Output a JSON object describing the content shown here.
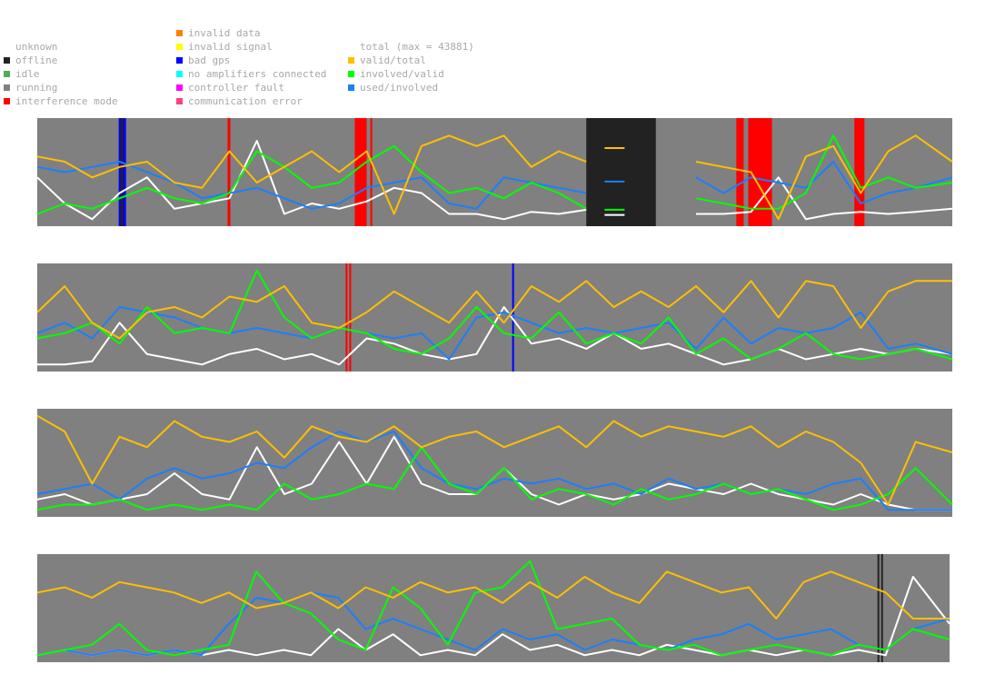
{
  "legend": {
    "status": [
      {
        "label": "unknown",
        "color": null
      },
      {
        "label": "offline",
        "color": "#222222"
      },
      {
        "label": "idle",
        "color": "#4caf50"
      },
      {
        "label": "running",
        "color": "#808080"
      },
      {
        "label": "interference mode",
        "color": "#ff0000"
      }
    ],
    "faults": [
      {
        "label": "invalid data",
        "color": "#ff8000"
      },
      {
        "label": "invalid signal",
        "color": "#ffff00"
      },
      {
        "label": "bad gps",
        "color": "#0000ff"
      },
      {
        "label": "no amplifiers connected",
        "color": "#00ffff"
      },
      {
        "label": "controller fault",
        "color": "#ff00ff"
      },
      {
        "label": "communication error",
        "color": "#ff4080"
      }
    ],
    "series": [
      {
        "label": "total (max = 43881)",
        "color": null
      },
      {
        "label": "valid/total",
        "color": "#ffbf00"
      },
      {
        "label": "involved/valid",
        "color": "#00ff00"
      },
      {
        "label": "used/involved",
        "color": "#1a7fff"
      }
    ]
  },
  "chart_data": {
    "type": "line",
    "background_color": "#808080",
    "series_colors": {
      "total": "#ffffff",
      "valid/total": "#ffbf00",
      "involved/valid": "#00ff00",
      "used/involved": "#1a7fff"
    },
    "ylim": [
      0,
      1
    ],
    "panels": [
      {
        "x": [
          0,
          0.03,
          0.06,
          0.09,
          0.12,
          0.15,
          0.18,
          0.21,
          0.24,
          0.27,
          0.3,
          0.33,
          0.36,
          0.39,
          0.42,
          0.45,
          0.48,
          0.51,
          0.54,
          0.57,
          0.6,
          0.63,
          0.66,
          0.69,
          0.72,
          0.75,
          0.78,
          0.81,
          0.84,
          0.87,
          0.9,
          0.93,
          0.96,
          1
        ],
        "total": [
          0.45,
          0.2,
          0.05,
          0.3,
          0.45,
          0.15,
          0.2,
          0.25,
          0.8,
          0.1,
          0.2,
          0.15,
          0.22,
          0.35,
          0.3,
          0.1,
          0.1,
          0.05,
          0.12,
          0.1,
          0.14,
          null,
          null,
          null,
          0.1,
          0.1,
          0.12,
          0.45,
          0.05,
          0.1,
          0.12,
          0.1,
          0.12,
          0.15
        ],
        "valid/total": [
          0.65,
          0.6,
          0.45,
          0.55,
          0.6,
          0.4,
          0.35,
          0.7,
          0.4,
          0.55,
          0.7,
          0.5,
          0.7,
          0.1,
          0.75,
          0.85,
          0.75,
          0.85,
          0.55,
          0.7,
          0.6,
          null,
          null,
          null,
          0.6,
          0.55,
          0.5,
          0.05,
          0.65,
          0.75,
          0.3,
          0.7,
          0.85,
          0.6
        ],
        "involved/valid": [
          0.1,
          0.2,
          0.15,
          0.25,
          0.35,
          0.25,
          0.2,
          0.3,
          0.7,
          0.55,
          0.35,
          0.4,
          0.6,
          0.75,
          0.5,
          0.3,
          0.35,
          0.25,
          0.4,
          0.3,
          0.15,
          null,
          null,
          null,
          0.25,
          0.2,
          0.15,
          0.15,
          0.3,
          0.85,
          0.35,
          0.45,
          0.35,
          0.4
        ],
        "used/involved": [
          0.55,
          0.5,
          0.55,
          0.6,
          0.5,
          0.4,
          0.25,
          0.3,
          0.35,
          0.25,
          0.15,
          0.2,
          0.35,
          0.4,
          0.45,
          0.2,
          0.15,
          0.45,
          0.4,
          0.35,
          0.3,
          null,
          null,
          null,
          0.45,
          0.3,
          0.45,
          0.4,
          0.35,
          0.6,
          0.2,
          0.3,
          0.35,
          0.45
        ],
        "end_marks": {
          "x": 0.62,
          "valid/total": 0.73,
          "used/involved": 0.41,
          "involved/valid": 0.14,
          "total": 0.09
        },
        "bands": [
          {
            "from": 0.089,
            "to": 0.097,
            "color": "#0000ff"
          },
          {
            "from": 0.091,
            "to": 0.094,
            "color": "#222222"
          },
          {
            "from": 0.208,
            "to": 0.211,
            "color": "#ff0000"
          },
          {
            "from": 0.347,
            "to": 0.36,
            "color": "#ff0000"
          },
          {
            "from": 0.364,
            "to": 0.366,
            "color": "#ff0000"
          },
          {
            "from": 0.6,
            "to": 0.676,
            "color": "#222222"
          },
          {
            "from": 0.764,
            "to": 0.772,
            "color": "#ff0000"
          },
          {
            "from": 0.777,
            "to": 0.803,
            "color": "#ff0000"
          },
          {
            "from": 0.893,
            "to": 0.904,
            "color": "#ff0000"
          }
        ]
      },
      {
        "x": [
          0,
          0.03,
          0.06,
          0.09,
          0.12,
          0.15,
          0.18,
          0.21,
          0.24,
          0.27,
          0.3,
          0.33,
          0.36,
          0.39,
          0.42,
          0.45,
          0.48,
          0.51,
          0.54,
          0.57,
          0.6,
          0.63,
          0.66,
          0.69,
          0.72,
          0.75,
          0.78,
          0.81,
          0.84,
          0.87,
          0.9,
          0.93,
          0.96,
          1
        ],
        "total": [
          0.05,
          0.05,
          0.08,
          0.45,
          0.15,
          0.1,
          0.05,
          0.15,
          0.2,
          0.1,
          0.15,
          0.05,
          0.3,
          0.25,
          0.15,
          0.1,
          0.15,
          0.6,
          0.25,
          0.3,
          0.2,
          0.35,
          0.2,
          0.25,
          0.15,
          0.05,
          0.1,
          0.2,
          0.1,
          0.15,
          0.2,
          0.15,
          0.2,
          0.15
        ],
        "valid/total": [
          0.55,
          0.8,
          0.45,
          0.3,
          0.55,
          0.6,
          0.5,
          0.7,
          0.65,
          0.8,
          0.45,
          0.4,
          0.55,
          0.75,
          0.6,
          0.45,
          0.75,
          0.45,
          0.8,
          0.65,
          0.85,
          0.6,
          0.75,
          0.6,
          0.8,
          0.55,
          0.85,
          0.5,
          0.85,
          0.8,
          0.4,
          0.75,
          0.85,
          0.85
        ],
        "involved/valid": [
          0.3,
          0.35,
          0.45,
          0.25,
          0.6,
          0.35,
          0.4,
          0.35,
          0.95,
          0.5,
          0.3,
          0.4,
          0.35,
          0.2,
          0.15,
          0.3,
          0.6,
          0.35,
          0.3,
          0.55,
          0.25,
          0.35,
          0.25,
          0.5,
          0.15,
          0.3,
          0.1,
          0.2,
          0.35,
          0.15,
          0.1,
          0.15,
          0.2,
          0.1
        ],
        "used/involved": [
          0.35,
          0.45,
          0.3,
          0.6,
          0.55,
          0.5,
          0.4,
          0.35,
          0.4,
          0.35,
          0.3,
          0.4,
          0.35,
          0.3,
          0.35,
          0.1,
          0.5,
          0.55,
          0.45,
          0.35,
          0.4,
          0.35,
          0.4,
          0.45,
          0.2,
          0.5,
          0.25,
          0.4,
          0.35,
          0.4,
          0.55,
          0.2,
          0.25,
          0.15
        ],
        "bands": [
          {
            "from": 0.337,
            "to": 0.339,
            "color": "#ff0000"
          },
          {
            "from": 0.341,
            "to": 0.343,
            "color": "#ff0000"
          },
          {
            "from": 0.519,
            "to": 0.521,
            "color": "#0000ff"
          }
        ]
      },
      {
        "x": [
          0,
          0.03,
          0.06,
          0.09,
          0.12,
          0.15,
          0.18,
          0.21,
          0.24,
          0.27,
          0.3,
          0.33,
          0.36,
          0.39,
          0.42,
          0.45,
          0.48,
          0.51,
          0.54,
          0.57,
          0.6,
          0.63,
          0.66,
          0.69,
          0.72,
          0.75,
          0.78,
          0.81,
          0.84,
          0.87,
          0.9,
          0.93,
          0.96,
          1
        ],
        "total": [
          0.15,
          0.2,
          0.1,
          0.15,
          0.2,
          0.4,
          0.2,
          0.15,
          0.65,
          0.2,
          0.3,
          0.7,
          0.3,
          0.75,
          0.3,
          0.2,
          0.2,
          0.45,
          0.2,
          0.1,
          0.2,
          0.15,
          0.2,
          0.3,
          0.25,
          0.2,
          0.3,
          0.2,
          0.15,
          0.1,
          0.2,
          0.1,
          0.05,
          0.05
        ],
        "valid/total": [
          0.95,
          0.8,
          0.3,
          0.75,
          0.65,
          0.9,
          0.75,
          0.7,
          0.8,
          0.55,
          0.85,
          0.75,
          0.7,
          0.85,
          0.65,
          0.75,
          0.8,
          0.65,
          0.75,
          0.85,
          0.65,
          0.9,
          0.75,
          0.85,
          0.8,
          0.75,
          0.85,
          0.65,
          0.8,
          0.7,
          0.5,
          0.1,
          0.7,
          0.6
        ],
        "involved/valid": [
          0.05,
          0.1,
          0.1,
          0.15,
          0.05,
          0.1,
          0.05,
          0.1,
          0.05,
          0.3,
          0.15,
          0.2,
          0.3,
          0.25,
          0.65,
          0.3,
          0.2,
          0.45,
          0.15,
          0.25,
          0.2,
          0.1,
          0.25,
          0.15,
          0.2,
          0.3,
          0.2,
          0.25,
          0.15,
          0.05,
          0.1,
          0.2,
          0.45,
          0.1
        ],
        "used/involved": [
          0.2,
          0.25,
          0.3,
          0.15,
          0.35,
          0.45,
          0.35,
          0.4,
          0.5,
          0.45,
          0.65,
          0.8,
          0.7,
          0.8,
          0.45,
          0.3,
          0.25,
          0.35,
          0.3,
          0.35,
          0.25,
          0.3,
          0.2,
          0.35,
          0.25,
          0.3,
          0.2,
          0.25,
          0.2,
          0.3,
          0.35,
          0.05,
          0.05,
          0.05
        ],
        "bands": []
      },
      {
        "x": [
          0,
          0.03,
          0.06,
          0.09,
          0.12,
          0.15,
          0.18,
          0.21,
          0.24,
          0.27,
          0.3,
          0.33,
          0.36,
          0.39,
          0.42,
          0.45,
          0.48,
          0.51,
          0.54,
          0.57,
          0.6,
          0.63,
          0.66,
          0.69,
          0.72,
          0.75,
          0.78,
          0.81,
          0.84,
          0.87,
          0.9,
          0.93,
          0.96,
          1
        ],
        "total": [
          0.05,
          0.1,
          0.05,
          0.1,
          0.05,
          0.1,
          0.05,
          0.1,
          0.05,
          0.1,
          0.05,
          0.3,
          0.1,
          0.25,
          0.05,
          0.1,
          0.05,
          0.25,
          0.1,
          0.15,
          0.05,
          0.1,
          0.05,
          0.15,
          0.1,
          0.05,
          0.1,
          0.05,
          0.1,
          0.05,
          0.1,
          0.05,
          0.8,
          0.35
        ],
        "valid/total": [
          0.65,
          0.7,
          0.6,
          0.75,
          0.7,
          0.65,
          0.55,
          0.65,
          0.5,
          0.55,
          0.65,
          0.5,
          0.7,
          0.6,
          0.75,
          0.65,
          0.7,
          0.55,
          0.75,
          0.6,
          0.8,
          0.65,
          0.55,
          0.85,
          0.75,
          0.65,
          0.7,
          0.4,
          0.75,
          0.85,
          0.75,
          0.65,
          0.4,
          0.4
        ],
        "involved/valid": [
          0.05,
          0.1,
          0.15,
          0.35,
          0.1,
          0.05,
          0.1,
          0.15,
          0.85,
          0.55,
          0.45,
          0.2,
          0.1,
          0.7,
          0.5,
          0.15,
          0.65,
          0.7,
          0.95,
          0.3,
          0.35,
          0.4,
          0.15,
          0.1,
          0.15,
          0.05,
          0.1,
          0.15,
          0.1,
          0.05,
          0.15,
          0.1,
          0.3,
          0.2
        ],
        "used/involved": [
          0.05,
          0.1,
          0.05,
          0.1,
          0.05,
          0.1,
          0.05,
          0.35,
          0.6,
          0.55,
          0.65,
          0.6,
          0.3,
          0.4,
          0.3,
          0.2,
          0.1,
          0.3,
          0.2,
          0.25,
          0.1,
          0.2,
          0.15,
          0.1,
          0.2,
          0.25,
          0.35,
          0.2,
          0.25,
          0.3,
          0.15,
          0.1,
          0.3,
          0.4
        ],
        "bands": [
          {
            "from": 0.921,
            "to": 0.923,
            "color": "#222222"
          },
          {
            "from": 0.925,
            "to": 0.927,
            "color": "#222222"
          }
        ]
      }
    ]
  }
}
